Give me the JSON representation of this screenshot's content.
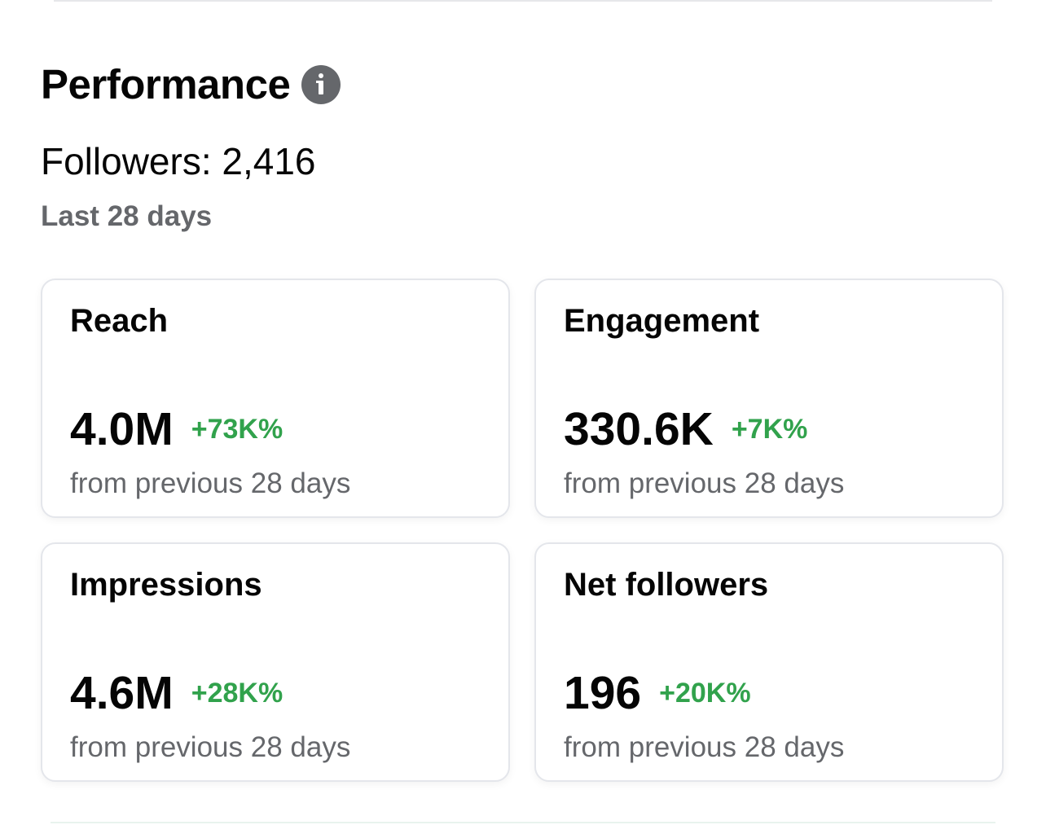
{
  "section": {
    "title": "Performance",
    "info_icon": "info-icon",
    "followers_text": "Followers: 2,416",
    "period": "Last 28 days"
  },
  "cards": [
    {
      "title": "Reach",
      "value": "4.0M",
      "change": "+73K%",
      "subtitle": "from previous 28 days"
    },
    {
      "title": "Engagement",
      "value": "330.6K",
      "change": "+7K%",
      "subtitle": "from previous 28 days"
    },
    {
      "title": "Impressions",
      "value": "4.6M",
      "change": "+28K%",
      "subtitle": "from previous 28 days"
    },
    {
      "title": "Net followers",
      "value": "196",
      "change": "+20K%",
      "subtitle": "from previous 28 days"
    }
  ],
  "colors": {
    "positive_change": "#31a24c",
    "secondary_text": "#65676b",
    "primary_text": "#050505",
    "card_border": "#e4e6eb"
  }
}
